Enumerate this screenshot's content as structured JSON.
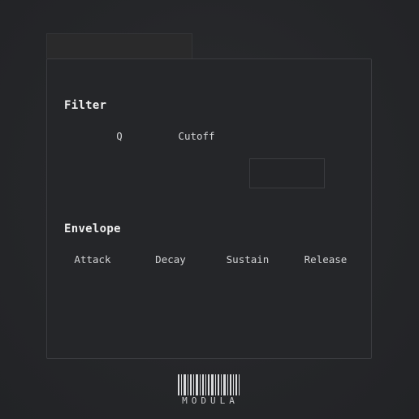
{
  "filter": {
    "title": "Filter",
    "knobs": [
      "Q",
      "Cutoff"
    ]
  },
  "envelope": {
    "title": "Envelope",
    "knobs": [
      "Attack",
      "Decay",
      "Sustain",
      "Release"
    ]
  },
  "brand": {
    "name": "MODULA",
    "logo_icon": "barcode-logo-icon"
  },
  "colors": {
    "background": "#252629",
    "text": "#f0f0f0",
    "border": "#3a3b3f"
  }
}
